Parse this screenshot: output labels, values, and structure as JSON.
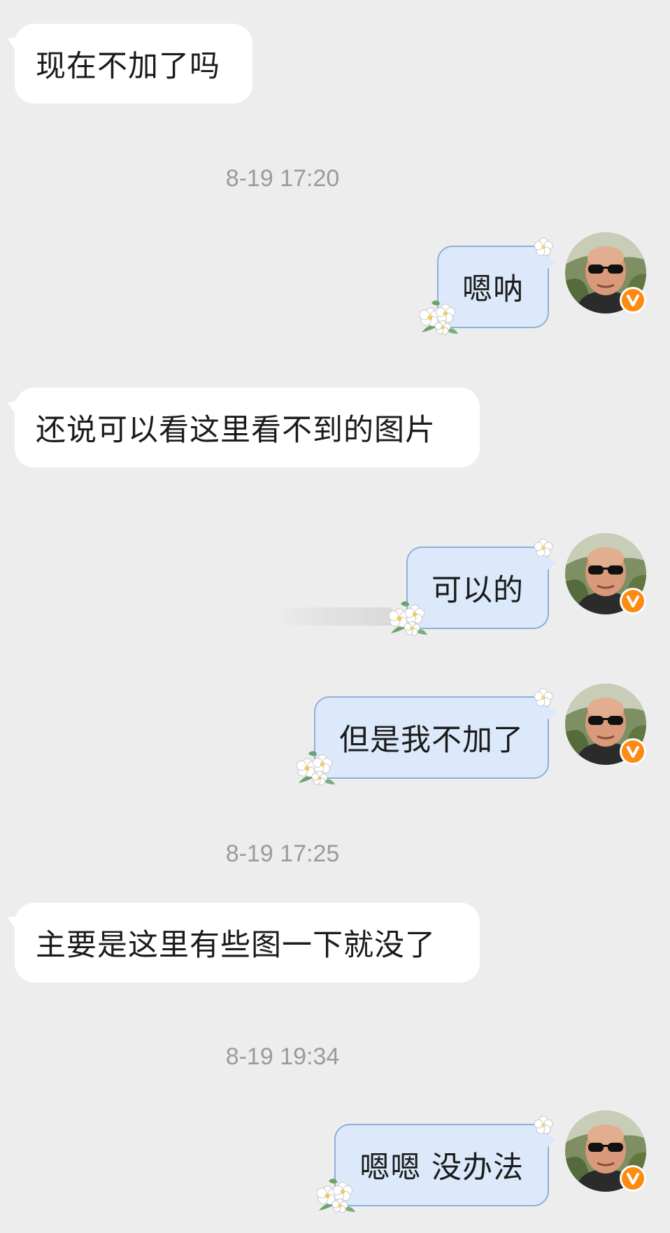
{
  "messages": [
    {
      "side": "in",
      "text": "现在不加了吗"
    },
    {
      "side": "out",
      "text": "嗯呐"
    },
    {
      "side": "in",
      "text": "还说可以看这里看不到的图片"
    },
    {
      "side": "out",
      "text": "可以的"
    },
    {
      "side": "out",
      "text": "但是我不加了"
    },
    {
      "side": "in",
      "text": "主要是这里有些图一下就没了"
    },
    {
      "side": "out",
      "text": "嗯嗯 没办法"
    }
  ],
  "timestamps": [
    "8-19 17:20",
    "8-19 17:25",
    "8-19 19:34"
  ],
  "avatar": {
    "icon": "user-avatar-sunglasses",
    "badge_icon": "verified-v-badge",
    "badge_color": "#ff8a12"
  },
  "colors": {
    "background": "#ededed",
    "incoming_bubble": "#ffffff",
    "outgoing_bubble": "#dbe9fb",
    "outgoing_border": "#8fb0d8",
    "timestamp": "#9b9b9b"
  }
}
